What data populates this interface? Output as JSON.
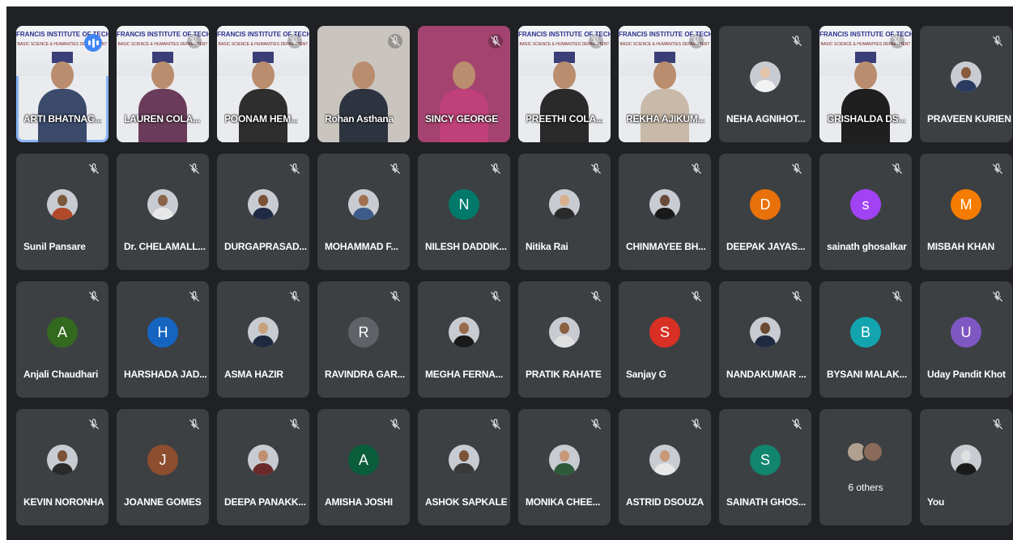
{
  "tiles": [
    {
      "name": "ARTI BHATNAG...",
      "type": "video",
      "poster": true,
      "active": true,
      "speaking": true,
      "muted": false,
      "poster_title": "FRANCIS INSTITUTE OF TECHNOLOG",
      "shirt": "#3b4a6b"
    },
    {
      "name": "LAUREN COLA...",
      "type": "video",
      "poster": true,
      "muted": true,
      "poster_title": "FRANCIS INSTITUTE OF TECHNOLOGY",
      "shirt": "#6a3b5a"
    },
    {
      "name": "POONAM HEM...",
      "type": "video",
      "poster": true,
      "muted": true,
      "poster_title": "FRANCIS INSTITUTE OF TECHNOLOG",
      "shirt": "#2e2e2e"
    },
    {
      "name": "Rohan Asthana",
      "type": "video",
      "poster": false,
      "bg": "#c9c4be",
      "muted": true,
      "shirt": "#2d3440"
    },
    {
      "name": "SINCY GEORGE",
      "type": "video",
      "poster": false,
      "bg": "#a4436f",
      "muted": true,
      "shirt": "#c0407a"
    },
    {
      "name": "PREETHI COLA...",
      "type": "video",
      "poster": true,
      "muted": true,
      "poster_title": "FRANCIS INSTITUTE OF TECHNOLOGY",
      "shirt": "#2a2a2a"
    },
    {
      "name": "REKHA AJIKUM...",
      "type": "video",
      "poster": true,
      "muted": true,
      "poster_title": "FRANCIS INSTITUTE OF TECHNOLOG",
      "shirt": "#c8b9a8"
    },
    {
      "name": "NEHA AGNIHOT...",
      "type": "photo",
      "muted": true,
      "skin": "#e2c4aa",
      "shirt": "#f2f2f2"
    },
    {
      "name": "GRISHALDA DS...",
      "type": "video",
      "poster": true,
      "muted": true,
      "poster_title": "FRANCIS INSTITUTE OF TECHNOLOG",
      "shirt": "#1f1f1f"
    },
    {
      "name": "PRAVEEN KURIEN",
      "type": "photo",
      "muted": true,
      "skin": "#8a5a3c",
      "shirt": "#2a3a60"
    },
    {
      "name": "Sunil Pansare",
      "type": "photo",
      "muted": true,
      "skin": "#7a5a3a",
      "shirt": "#b04a2a"
    },
    {
      "name": "Dr. CHELAMALL...",
      "type": "photo",
      "muted": true,
      "skin": "#8a6448",
      "shirt": "#e8e8e8"
    },
    {
      "name": "DURGAPRASAD...",
      "type": "photo",
      "muted": true,
      "skin": "#7a5238",
      "shirt": "#1f2a44"
    },
    {
      "name": "MOHAMMAD F...",
      "type": "photo",
      "muted": true,
      "skin": "#a07050",
      "shirt": "#3e5c8a"
    },
    {
      "name": "NILESH DADDIK...",
      "type": "letter",
      "letter": "N",
      "color": "#00796b",
      "muted": true
    },
    {
      "name": "Nitika Rai",
      "type": "photo",
      "muted": true,
      "skin": "#d8b090",
      "shirt": "#2a2a2a"
    },
    {
      "name": "CHINMAYEE BH...",
      "type": "photo",
      "muted": true,
      "skin": "#6a4a38",
      "shirt": "#1a1a1a"
    },
    {
      "name": "DEEPAK JAYAS...",
      "type": "letter",
      "letter": "D",
      "color": "#e8710a",
      "muted": true
    },
    {
      "name": "sainath ghosalkar",
      "type": "letter",
      "letter": "s",
      "color": "#a142f4",
      "muted": true
    },
    {
      "name": "MISBAH KHAN",
      "type": "letter",
      "letter": "M",
      "color": "#f57c00",
      "muted": true
    },
    {
      "name": "Anjali Chaudhari",
      "type": "letter",
      "letter": "A",
      "color": "#33691e",
      "muted": true
    },
    {
      "name": "HARSHADA JAD...",
      "type": "letter",
      "letter": "H",
      "color": "#1565c0",
      "muted": true
    },
    {
      "name": "ASMA HAZIR",
      "type": "photo",
      "muted": true,
      "skin": "#c8a080",
      "shirt": "#1d2a40"
    },
    {
      "name": "RAVINDRA GAR...",
      "type": "letter",
      "letter": "R",
      "color": "#5f6368",
      "muted": true
    },
    {
      "name": "MEGHA FERNA...",
      "type": "photo",
      "muted": true,
      "skin": "#9a6a4a",
      "shirt": "#1a1a1a"
    },
    {
      "name": "PRATIK RAHATE",
      "type": "photo",
      "muted": true,
      "skin": "#8a6040",
      "shirt": "#e0e0e0"
    },
    {
      "name": "Sanjay G",
      "type": "letter",
      "letter": "S",
      "color": "#d93025",
      "muted": true
    },
    {
      "name": "NANDAKUMAR ...",
      "type": "photo",
      "muted": true,
      "skin": "#6a4a30",
      "shirt": "#1d2a40"
    },
    {
      "name": "BYSANI MALAK...",
      "type": "letter",
      "letter": "B",
      "color": "#12a4af",
      "muted": true
    },
    {
      "name": "Uday Pandit Khot",
      "type": "letter",
      "letter": "U",
      "color": "#7e57c2",
      "muted": true
    },
    {
      "name": "KEVIN NORONHA",
      "type": "photo",
      "muted": true,
      "skin": "#7a5238",
      "shirt": "#2a2a2a"
    },
    {
      "name": "JOANNE GOMES",
      "type": "letter",
      "letter": "J",
      "color": "#8d4e2f",
      "muted": true
    },
    {
      "name": "DEEPA PANAKK...",
      "type": "photo",
      "muted": true,
      "skin": "#c09070",
      "shirt": "#6a2a2a"
    },
    {
      "name": "AMISHA JOSHI",
      "type": "letter",
      "letter": "A",
      "color": "#0b5e3c",
      "muted": true
    },
    {
      "name": "ASHOK SAPKALE",
      "type": "photo",
      "muted": true,
      "skin": "#7a5238",
      "shirt": "#3a3a3a"
    },
    {
      "name": "MONIKA CHEE...",
      "type": "photo",
      "muted": true,
      "skin": "#c89878",
      "shirt": "#2f5a3a"
    },
    {
      "name": "ASTRID DSOUZA",
      "type": "photo",
      "muted": true,
      "skin": "#c89878",
      "shirt": "#e8e8e8"
    },
    {
      "name": "SAINATH GHOS...",
      "type": "letter",
      "letter": "S",
      "color": "#12856f",
      "muted": true
    },
    {
      "name": "",
      "type": "others",
      "others_label": "6 others",
      "muted": false
    },
    {
      "name": "You",
      "type": "photo",
      "muted": true,
      "skin": "#e0e0e0",
      "shirt": "#1a1a1a"
    }
  ],
  "poster_subtitle": "BASIC SCIENCE & HUMANITIES DEPARTMENT",
  "colors": {
    "background": "#202124",
    "tile": "#3c4043",
    "active_outline": "#8ab4f8",
    "speaking": "#4285f4"
  },
  "icons": {
    "mute": "mic-off-icon",
    "speaking": "audio-level-icon"
  }
}
